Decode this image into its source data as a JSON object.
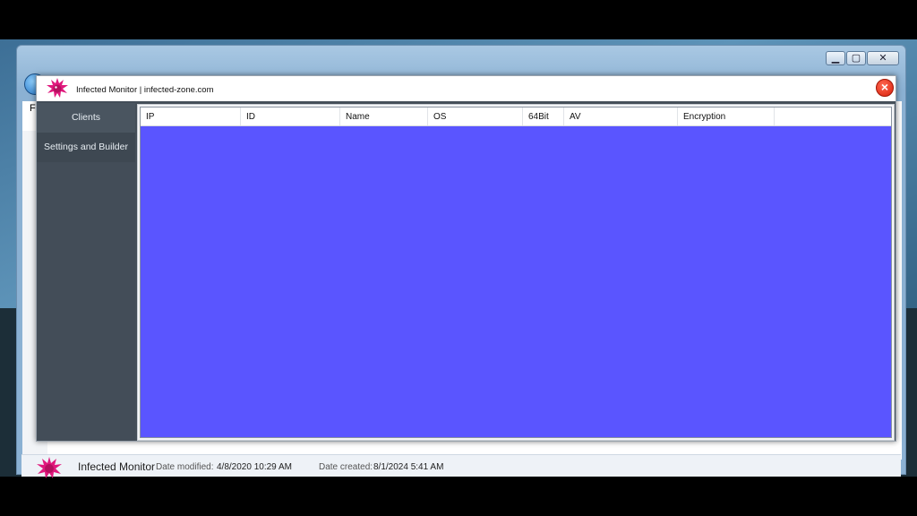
{
  "explorer": {
    "menu_fragment": "Fi",
    "caption_buttons": {
      "minimize": "▁",
      "maximize": "▢",
      "close": "✕"
    }
  },
  "app": {
    "title": "Infected Monitor | infected-zone.com",
    "close_symbol": "×",
    "sidebar": {
      "items": [
        {
          "label": "Clients"
        },
        {
          "label": "Settings and Builder"
        }
      ]
    },
    "table": {
      "columns": [
        "IP",
        "ID",
        "Name",
        "OS",
        "64Bit",
        "AV",
        "Encryption",
        ""
      ],
      "background_color": "#5a55ff"
    }
  },
  "details": {
    "name": "Infected Monitor",
    "modified_label": "Date modified:",
    "modified_value": "4/8/2020 10:29 AM",
    "created_label": "Date created:",
    "created_value": "8/1/2024 5:41 AM"
  },
  "colors": {
    "logo": "#e0197d",
    "close": "#e52a14",
    "sidebar": "#434d58"
  },
  "icons": [
    "virus-logo-icon",
    "close-icon",
    "back-arrow-icon"
  ]
}
